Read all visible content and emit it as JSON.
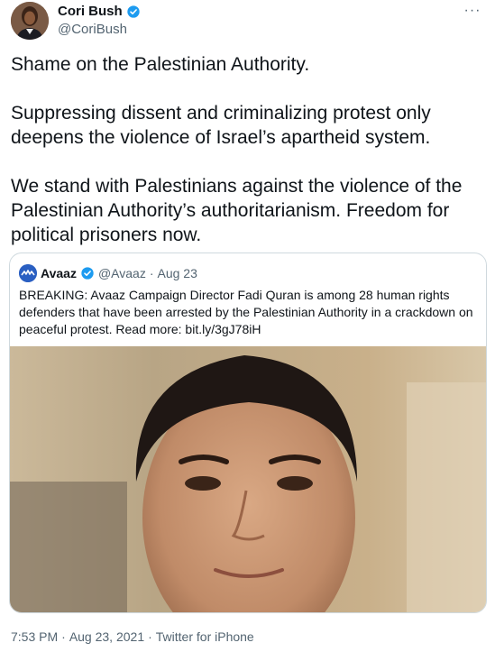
{
  "author": {
    "name": "Cori Bush",
    "handle": "@CoriBush",
    "verified": true,
    "avatar_icon": "profile-photo"
  },
  "more_icon": "more-horizontal-icon",
  "more_glyph": "···",
  "tweet": {
    "paragraphs": [
      "Shame on the Palestinian Authority.",
      "Suppressing dissent and criminalizing protest only deepens the violence of Israel’s apartheid system.",
      "We stand with Palestinians against the violence of the Palestinian Authority’s authoritarianism. Freedom for political prisoners now."
    ]
  },
  "quote": {
    "name": "Avaaz",
    "handle": "@Avaaz",
    "separator": "·",
    "date": "Aug 23",
    "verified": true,
    "text": "BREAKING: Avaaz Campaign Director Fadi Quran is among 28 human rights defenders that have been arrested by the Palestinian Authority in a crackdown on peaceful protest. Read more: bit.ly/3gJ78iH",
    "media_icon": "photo-of-man"
  },
  "meta": {
    "time": "7:53 PM",
    "sep1": "·",
    "date": "Aug 23, 2021",
    "sep2": "·",
    "source": "Twitter for iPhone"
  },
  "colors": {
    "verified": "#1d9bf0",
    "secondary_text": "#536471",
    "border": "#cfd9de",
    "avaaz_brand": "#2a5fc2"
  }
}
